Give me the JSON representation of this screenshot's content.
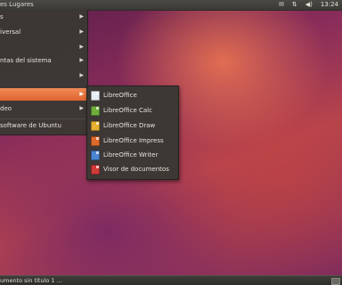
{
  "topbar": {
    "menus_text": "es  Lugares",
    "indicators": [
      "✉",
      "⇅",
      "◀)",
      "13:24"
    ]
  },
  "main_menu": {
    "items": [
      {
        "label": "s",
        "has_submenu": true
      },
      {
        "label": "iversal",
        "has_submenu": true
      },
      {
        "label": "",
        "has_submenu": true
      },
      {
        "label": "ntas del sistema",
        "has_submenu": true
      },
      {
        "label": "",
        "has_submenu": true
      },
      {
        "label": "",
        "has_submenu": true,
        "highlighted": true
      },
      {
        "label": "deo",
        "has_submenu": true
      },
      {
        "label": "software de Ubuntu",
        "has_submenu": false
      }
    ]
  },
  "submenu": {
    "items": [
      {
        "label": "LibreOffice",
        "icon": "libreoffice-icon",
        "color": "#e8eef6"
      },
      {
        "label": "LibreOffice Calc",
        "icon": "libreoffice-calc-icon",
        "color": "#6fae3c"
      },
      {
        "label": "LibreOffice Draw",
        "icon": "libreoffice-draw-icon",
        "color": "#e6b030"
      },
      {
        "label": "LibreOffice Impress",
        "icon": "libreoffice-impress-icon",
        "color": "#e06a2c"
      },
      {
        "label": "LibreOffice Writer",
        "icon": "libreoffice-writer-icon",
        "color": "#4a86d4"
      },
      {
        "label": "Visor de documentos",
        "icon": "document-viewer-icon",
        "color": "#d23a3a"
      }
    ]
  },
  "taskbar": {
    "task_label": "umento sin título 1 ..."
  }
}
